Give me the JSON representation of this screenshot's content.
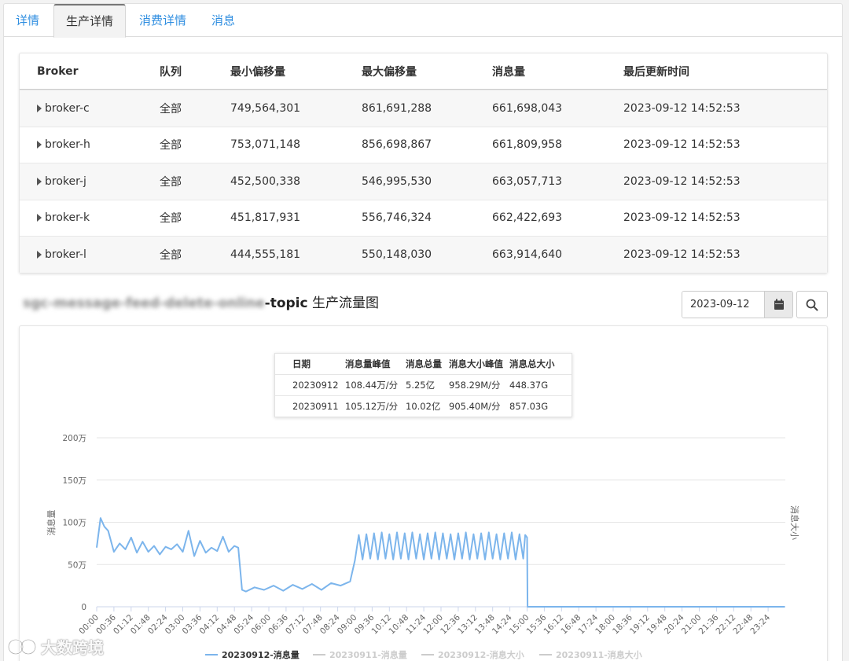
{
  "tabs": [
    {
      "label": "详情",
      "active": false
    },
    {
      "label": "生产详情",
      "active": true
    },
    {
      "label": "消费详情",
      "active": false
    },
    {
      "label": "消息",
      "active": false
    }
  ],
  "broker_table": {
    "headers": [
      "Broker",
      "队列",
      "最小偏移量",
      "最大偏移量",
      "消息量",
      "最后更新时间"
    ],
    "rows": [
      {
        "broker": "broker-c",
        "queue": "全部",
        "min_offset": "749,564,301",
        "max_offset": "861,691,288",
        "messages": "661,698,043",
        "updated": "2023-09-12 14:52:53"
      },
      {
        "broker": "broker-h",
        "queue": "全部",
        "min_offset": "753,071,148",
        "max_offset": "856,698,867",
        "messages": "661,809,958",
        "updated": "2023-09-12 14:52:53"
      },
      {
        "broker": "broker-j",
        "queue": "全部",
        "min_offset": "452,500,338",
        "max_offset": "546,995,530",
        "messages": "663,057,713",
        "updated": "2023-09-12 14:52:53"
      },
      {
        "broker": "broker-k",
        "queue": "全部",
        "min_offset": "451,817,931",
        "max_offset": "556,746,324",
        "messages": "662,422,693",
        "updated": "2023-09-12 14:52:53"
      },
      {
        "broker": "broker-l",
        "queue": "全部",
        "min_offset": "444,555,181",
        "max_offset": "550,148,030",
        "messages": "663,914,640",
        "updated": "2023-09-12 14:52:53"
      }
    ]
  },
  "chart_section": {
    "title_blurred": "sgc-message-feed-delete-online",
    "title_suffix": "-topic",
    "title_rest": " 生产流量图",
    "date_value": "2023-09-12",
    "calendar_icon": "calendar-icon",
    "search_icon": "search-icon"
  },
  "stats_table": {
    "headers": [
      "日期",
      "消息量峰值",
      "消息总量",
      "消息大小峰值",
      "消息总大小"
    ],
    "rows": [
      [
        "20230912",
        "108.44万/分",
        "5.25亿",
        "958.29M/分",
        "448.37G"
      ],
      [
        "20230911",
        "105.12万/分",
        "10.02亿",
        "905.40M/分",
        "857.03G"
      ]
    ]
  },
  "watermark": "大数跨境",
  "chart_data": {
    "type": "line",
    "ylabel": "消息量",
    "y2label": "消息大小",
    "ylim": [
      0,
      2000000
    ],
    "y_ticks": [
      "0",
      "50万",
      "100万",
      "150万",
      "200万"
    ],
    "x_ticks": [
      "00:00",
      "00:36",
      "01:12",
      "01:48",
      "02:24",
      "03:00",
      "03:36",
      "04:12",
      "04:48",
      "05:24",
      "06:00",
      "06:36",
      "07:12",
      "07:48",
      "08:24",
      "09:00",
      "09:36",
      "10:12",
      "10:48",
      "11:24",
      "12:00",
      "12:36",
      "13:12",
      "13:48",
      "14:24",
      "15:00",
      "15:36",
      "16:12",
      "16:48",
      "17:24",
      "18:00",
      "18:36",
      "19:12",
      "19:48",
      "20:24",
      "21:00",
      "21:36",
      "22:12",
      "22:48",
      "23:24"
    ],
    "grid": true,
    "legend_position": "bottom",
    "colors": {
      "series1": "#7cb5ec",
      "inactive": "#cccccc"
    },
    "series": [
      {
        "name": "20230912-消息量",
        "active": true,
        "time_minutes": [
          0,
          8,
          16,
          24,
          36,
          48,
          60,
          72,
          84,
          96,
          108,
          120,
          132,
          144,
          156,
          168,
          180,
          192,
          204,
          216,
          228,
          240,
          252,
          264,
          276,
          288,
          296,
          304,
          312,
          330,
          350,
          370,
          390,
          410,
          430,
          450,
          470,
          490,
          510,
          530,
          540,
          548,
          556,
          564,
          572,
          580,
          588,
          596,
          604,
          612,
          620,
          628,
          636,
          644,
          652,
          660,
          668,
          676,
          684,
          692,
          700,
          708,
          716,
          724,
          732,
          740,
          748,
          756,
          764,
          772,
          780,
          788,
          796,
          804,
          812,
          820,
          828,
          836,
          844,
          852,
          860,
          868,
          876,
          884,
          892,
          896,
          900,
          901,
          960,
          1080,
          1200,
          1320,
          1439
        ],
        "values": [
          700000,
          1050000,
          950000,
          900000,
          650000,
          750000,
          680000,
          820000,
          640000,
          770000,
          650000,
          720000,
          620000,
          710000,
          680000,
          740000,
          650000,
          900000,
          600000,
          780000,
          640000,
          700000,
          660000,
          830000,
          650000,
          720000,
          700000,
          200000,
          180000,
          230000,
          200000,
          250000,
          190000,
          260000,
          210000,
          270000,
          200000,
          280000,
          250000,
          300000,
          550000,
          850000,
          560000,
          860000,
          570000,
          870000,
          560000,
          880000,
          570000,
          860000,
          560000,
          880000,
          570000,
          870000,
          560000,
          880000,
          570000,
          860000,
          560000,
          870000,
          570000,
          880000,
          560000,
          870000,
          570000,
          860000,
          560000,
          870000,
          570000,
          880000,
          560000,
          860000,
          570000,
          870000,
          560000,
          880000,
          570000,
          860000,
          560000,
          870000,
          570000,
          880000,
          560000,
          860000,
          570000,
          850000,
          820000,
          0,
          0,
          0,
          0,
          0,
          0
        ]
      },
      {
        "name": "20230911-消息量",
        "active": false
      },
      {
        "name": "20230912-消息大小",
        "active": false
      },
      {
        "name": "20230911-消息大小",
        "active": false
      }
    ]
  }
}
